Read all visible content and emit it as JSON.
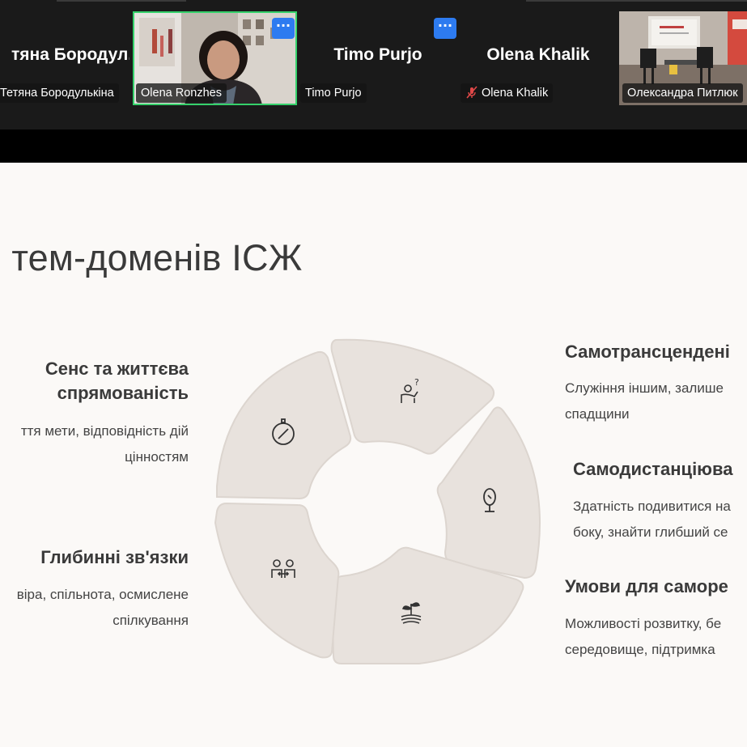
{
  "participants": {
    "tyetiana": {
      "name_large": "тяна Бородул...",
      "tag": "Тетяна Бородулькіна"
    },
    "olena_ronzhes": {
      "tag": "Olena Ronzhes",
      "more_label": "···"
    },
    "timo": {
      "name_large": "Timo Purjo",
      "tag": "Timo Purjo",
      "more_label": "···"
    },
    "olena_khalik": {
      "name_large": "Olena Khalik",
      "tag": "Olena Khalik"
    },
    "oleksandra": {
      "tag": "Олександра Питлюк"
    }
  },
  "slide": {
    "title": "ь тем-доменів ІСЖ",
    "left_items": [
      {
        "heading_line1": "Сенс та життєва",
        "heading_line2": "спрямованість",
        "text_line1": "ття мети, відповідність дій",
        "text_line2": "цінностям"
      },
      {
        "heading_line1": "Глибинні зв'язки",
        "text_line1": "віра, спільнота, осмислене",
        "text_line2": "спілкування"
      }
    ],
    "right_items": [
      {
        "heading": "Самотрансцендені",
        "text_line1": "Служіння іншим, залише",
        "text_line2": "спадщини"
      },
      {
        "heading": "Самодистанціюва",
        "text_line1": "Здатність подивитися на",
        "text_line2": "боку, знайти глибший се"
      },
      {
        "heading": "Умови для саморе",
        "text_line1": "Можливості розвитку, бе",
        "text_line2": "середовище, підтримка"
      }
    ]
  },
  "colors": {
    "segment_fill": "#e8e2dd",
    "segment_stroke": "#d8d2cc",
    "active_speaker": "#35d16b",
    "more_button": "#2d7bf0"
  },
  "icons": [
    "compass-icon",
    "person-question-icon",
    "mirror-icon",
    "plant-icon",
    "people-connection-icon"
  ]
}
